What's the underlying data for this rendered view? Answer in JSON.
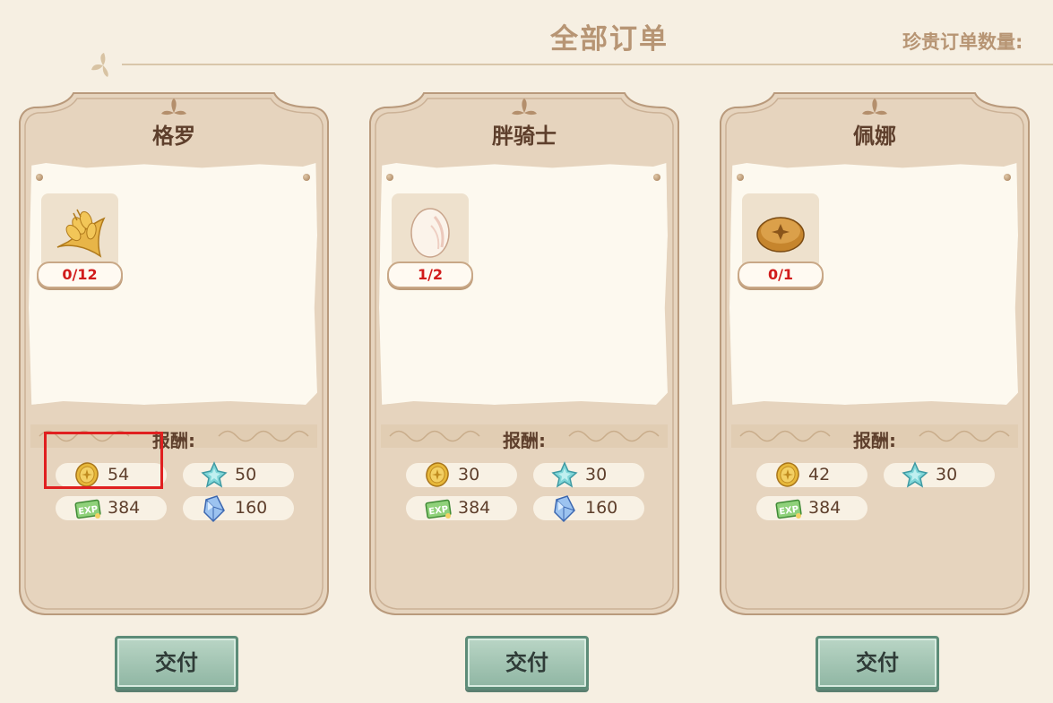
{
  "header": {
    "title": "全部订单",
    "rare_orders_label": "珍贵订单数量:"
  },
  "reward_label": "报酬:",
  "deliver_label": "交付",
  "orders": [
    {
      "name": "格罗",
      "item": {
        "icon": "wheat-icon",
        "progress": "0/12"
      },
      "rewards": {
        "gold": "54",
        "star": "50",
        "exp": "384",
        "crystal": "160"
      }
    },
    {
      "name": "胖骑士",
      "item": {
        "icon": "egg-icon",
        "progress": "1/2"
      },
      "rewards": {
        "gold": "30",
        "star": "30",
        "exp": "384",
        "crystal": "160"
      }
    },
    {
      "name": "佩娜",
      "item": {
        "icon": "bread-icon",
        "progress": "0/1"
      },
      "rewards": {
        "gold": "42",
        "star": "30",
        "exp": "384"
      }
    }
  ],
  "colors": {
    "background": "#f6efe2",
    "card": "#e4d2bc",
    "paper": "#fdf9ef",
    "count_text": "#d11b1b",
    "button": "#a8c9b6",
    "highlight": "#e02020"
  }
}
